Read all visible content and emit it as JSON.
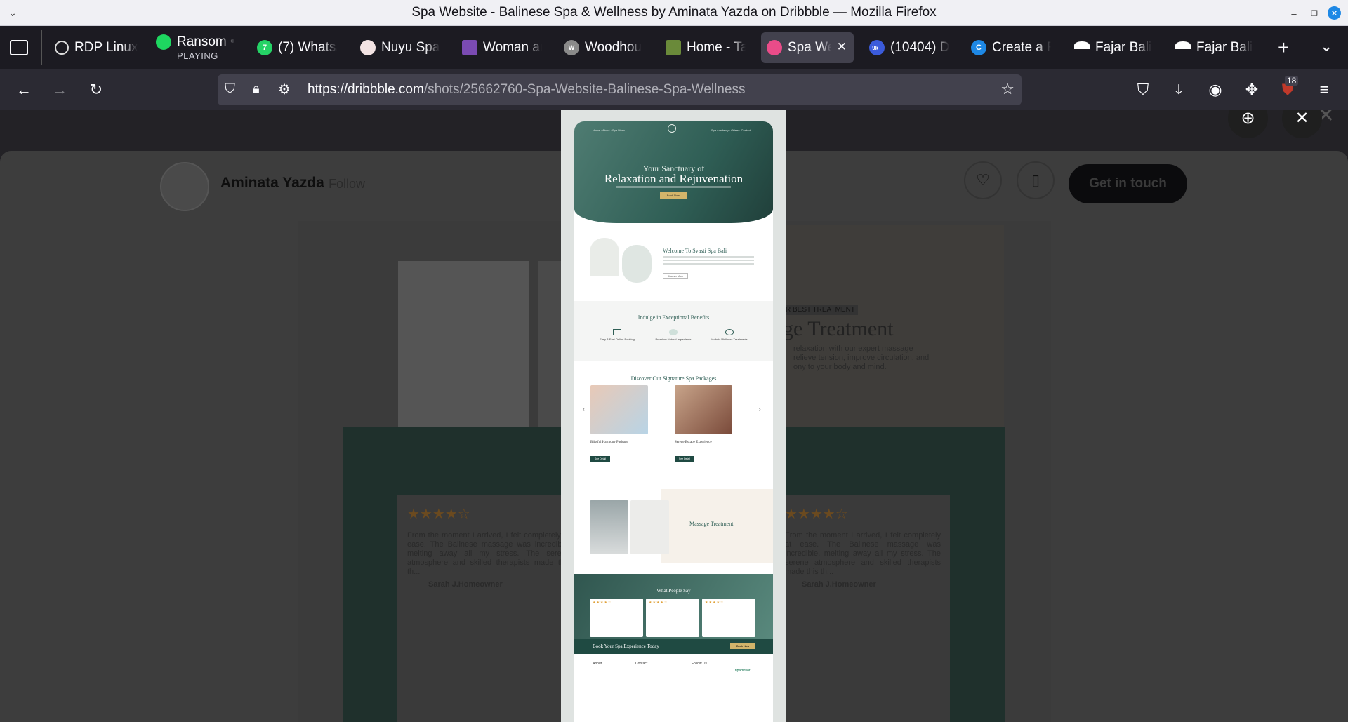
{
  "window": {
    "title": "Spa Website - Balinese Spa & Wellness by Aminata Yazda on Dribbble — Mozilla Firefox"
  },
  "tabs": [
    {
      "label": "RDP Linux",
      "icon": "openai-icon"
    },
    {
      "label": "Ransom •",
      "sub": "PLAYING",
      "icon": "spotify-icon"
    },
    {
      "label": "(7) Whats/",
      "icon": "whatsapp-icon",
      "badge": "7"
    },
    {
      "label": "Nuyu Spa",
      "icon": "site-icon"
    },
    {
      "label": "Woman ar",
      "icon": "site-icon"
    },
    {
      "label": "Woodhou",
      "icon": "site-icon"
    },
    {
      "label": "Home - Ta",
      "icon": "site-icon"
    },
    {
      "label": "Spa We",
      "icon": "dribbble-icon",
      "active": true
    },
    {
      "label": "(10404) D",
      "icon": "site-icon",
      "badge": "9k+"
    },
    {
      "label": "Create a F",
      "icon": "site-icon"
    },
    {
      "label": "Fajar Bali",
      "icon": "site-icon"
    },
    {
      "label": "Fajar Bali",
      "icon": "site-icon"
    }
  ],
  "url": {
    "host": "https://dribbble.com",
    "path": "/shots/25662760-Spa-Website-Balinese-Spa-Wellness"
  },
  "extension_badge": "18",
  "shot": {
    "author": "Aminata Yazda",
    "follow": "Follow",
    "get_in_touch": "Get in touch",
    "bg_tag": "R BEST TREATMENT",
    "bg_heading": "ge Treatment",
    "bg_text": "relaxation with our expert massage\nrelieve tension, improve circulation, and\nony to your body and mind.",
    "bg_review_left": "From the moment I arrived, I felt completely at ease. The Balinese massage was incredible, melting away all my stress. The serene atmosphere and skilled therapists made this th...",
    "bg_review_right": "From the moment I arrived, I felt completely at ease. The Balinese massage was incredible, melting away all my stress. The serene atmosphere and skilled therapists made this th...",
    "bg_reviewer": "Sarah J.Homeowner"
  },
  "mock": {
    "hero_line1": "Your Sanctuary of",
    "hero_line2": "Relaxation and Rejuvenation",
    "hero_btn": "Book Now",
    "welcome": "Welcome To Svasti Spa Bali",
    "discover": "Discover More",
    "benefits": "Indulge in Exceptional Benefits",
    "benefit1": "Easy & Fast Online Booking",
    "benefit2": "Premium Natural Ingredients",
    "benefit3": "Holistic Wellness Treatments",
    "packages": "Discover Our Signature Spa Packages",
    "pkg1": "Blissful Harmony Package",
    "pkg2": "Serene Escape Experience",
    "see_detail": "See Detail",
    "massage": "Massage Treatment",
    "people": "What People Say",
    "book": "Book Your Spa Experience Today",
    "book_btn": "Book Now",
    "footer_about": "About",
    "footer_contact": "Contact",
    "footer_follow": "Follow Us",
    "tripadvisor": "Tripadvisor"
  }
}
